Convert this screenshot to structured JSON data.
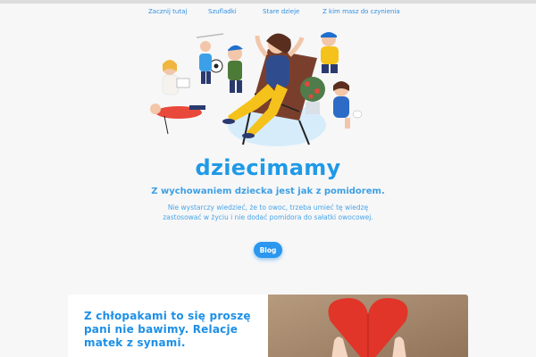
{
  "nav": {
    "items": [
      {
        "label": "Zacznij tutaj"
      },
      {
        "label": "Szufladki"
      },
      {
        "label": "Stare dzieje"
      },
      {
        "label": "Z kim masz do czynienia"
      }
    ]
  },
  "hero": {
    "brand": "dziecimamy",
    "tagline": "Z wychowaniem dziecka jest jak z pomidorem.",
    "description": "Nie wystarczy wiedzieć, że to owoc, trzeba umieć tę wiedzę zastosować w życiu i nie dodać pomidora do sałatki owocowej.",
    "cta_label": "Blog"
  },
  "featured": {
    "title": "Z chłopakami to się proszę pani nie bawimy. Relacje matek z synami."
  },
  "colors": {
    "accent": "#1f9ae6",
    "button": "#2b97ee",
    "background": "#f7f7f8"
  }
}
